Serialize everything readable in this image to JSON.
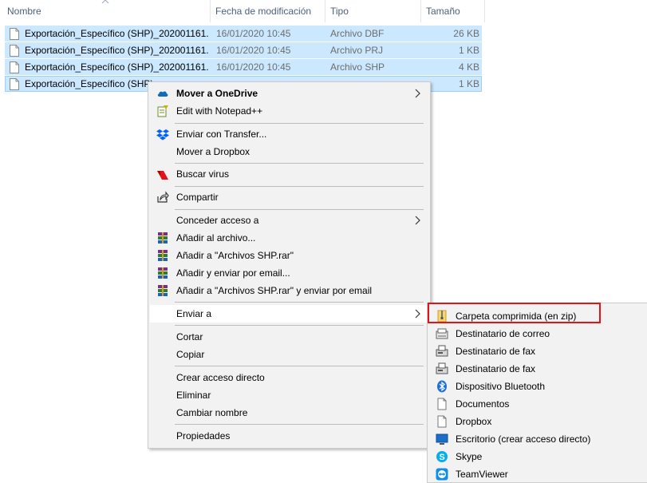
{
  "columns": {
    "name": "Nombre",
    "date": "Fecha de modificación",
    "type": "Tipo",
    "size": "Tamaño"
  },
  "files": [
    {
      "name": "Exportación_Específico (SHP)_202001161...",
      "date": "16/01/2020 10:45",
      "type": "Archivo DBF",
      "size": "26 KB"
    },
    {
      "name": "Exportación_Específico (SHP)_202001161...",
      "date": "16/01/2020 10:45",
      "type": "Archivo PRJ",
      "size": "1 KB"
    },
    {
      "name": "Exportación_Específico (SHP)_202001161...",
      "date": "16/01/2020 10:45",
      "type": "Archivo SHP",
      "size": "4 KB"
    },
    {
      "name": "Exportación_Específico (SHP)",
      "date": "",
      "type": "",
      "size": "1 KB"
    }
  ],
  "context_menu": {
    "items": [
      {
        "label": "Mover a OneDrive",
        "icon": "onedrive-icon",
        "submenu": true
      },
      {
        "label": "Edit with Notepad++",
        "icon": "notepadpp-icon"
      },
      {
        "label": "Enviar con Transfer...",
        "icon": "dropbox-icon"
      },
      {
        "label": "Mover a Dropbox",
        "icon": ""
      },
      {
        "label": "Buscar virus",
        "icon": "antivirus-icon"
      },
      {
        "label": "Compartir",
        "icon": "share-icon"
      },
      {
        "label": "Conceder acceso a",
        "icon": "",
        "submenu": true
      },
      {
        "label": "Añadir al archivo...",
        "icon": "winrar-icon"
      },
      {
        "label": "Añadir a \"Archivos SHP.rar\"",
        "icon": "winrar-icon"
      },
      {
        "label": "Añadir y enviar por email...",
        "icon": "winrar-icon"
      },
      {
        "label": "Añadir a \"Archivos SHP.rar\" y enviar por email",
        "icon": "winrar-icon"
      },
      {
        "label": "Enviar a",
        "icon": "",
        "submenu": true
      },
      {
        "label": "Cortar",
        "icon": ""
      },
      {
        "label": "Copiar",
        "icon": ""
      },
      {
        "label": "Crear acceso directo",
        "icon": ""
      },
      {
        "label": "Eliminar",
        "icon": ""
      },
      {
        "label": "Cambiar nombre",
        "icon": ""
      },
      {
        "label": "Propiedades",
        "icon": ""
      }
    ]
  },
  "send_to_menu": {
    "items": [
      {
        "label": "Carpeta comprimida (en zip)",
        "icon": "zip-folder-icon"
      },
      {
        "label": "Destinatario de correo",
        "icon": "mail-recipient-icon"
      },
      {
        "label": "Destinatario de fax",
        "icon": "fax-icon"
      },
      {
        "label": "Destinatario de fax",
        "icon": "fax-icon"
      },
      {
        "label": "Dispositivo Bluetooth",
        "icon": "bluetooth-icon"
      },
      {
        "label": "Documentos",
        "icon": "documents-icon"
      },
      {
        "label": "Dropbox",
        "icon": "dropbox-file-icon"
      },
      {
        "label": "Escritorio (crear acceso directo)",
        "icon": "desktop-icon"
      },
      {
        "label": "Skype",
        "icon": "skype-icon"
      },
      {
        "label": "TeamViewer",
        "icon": "teamviewer-icon"
      }
    ]
  },
  "colors": {
    "selection": "#cce8ff",
    "menu_bg": "#f2f2f2",
    "highlight_box": "#e2141a"
  }
}
